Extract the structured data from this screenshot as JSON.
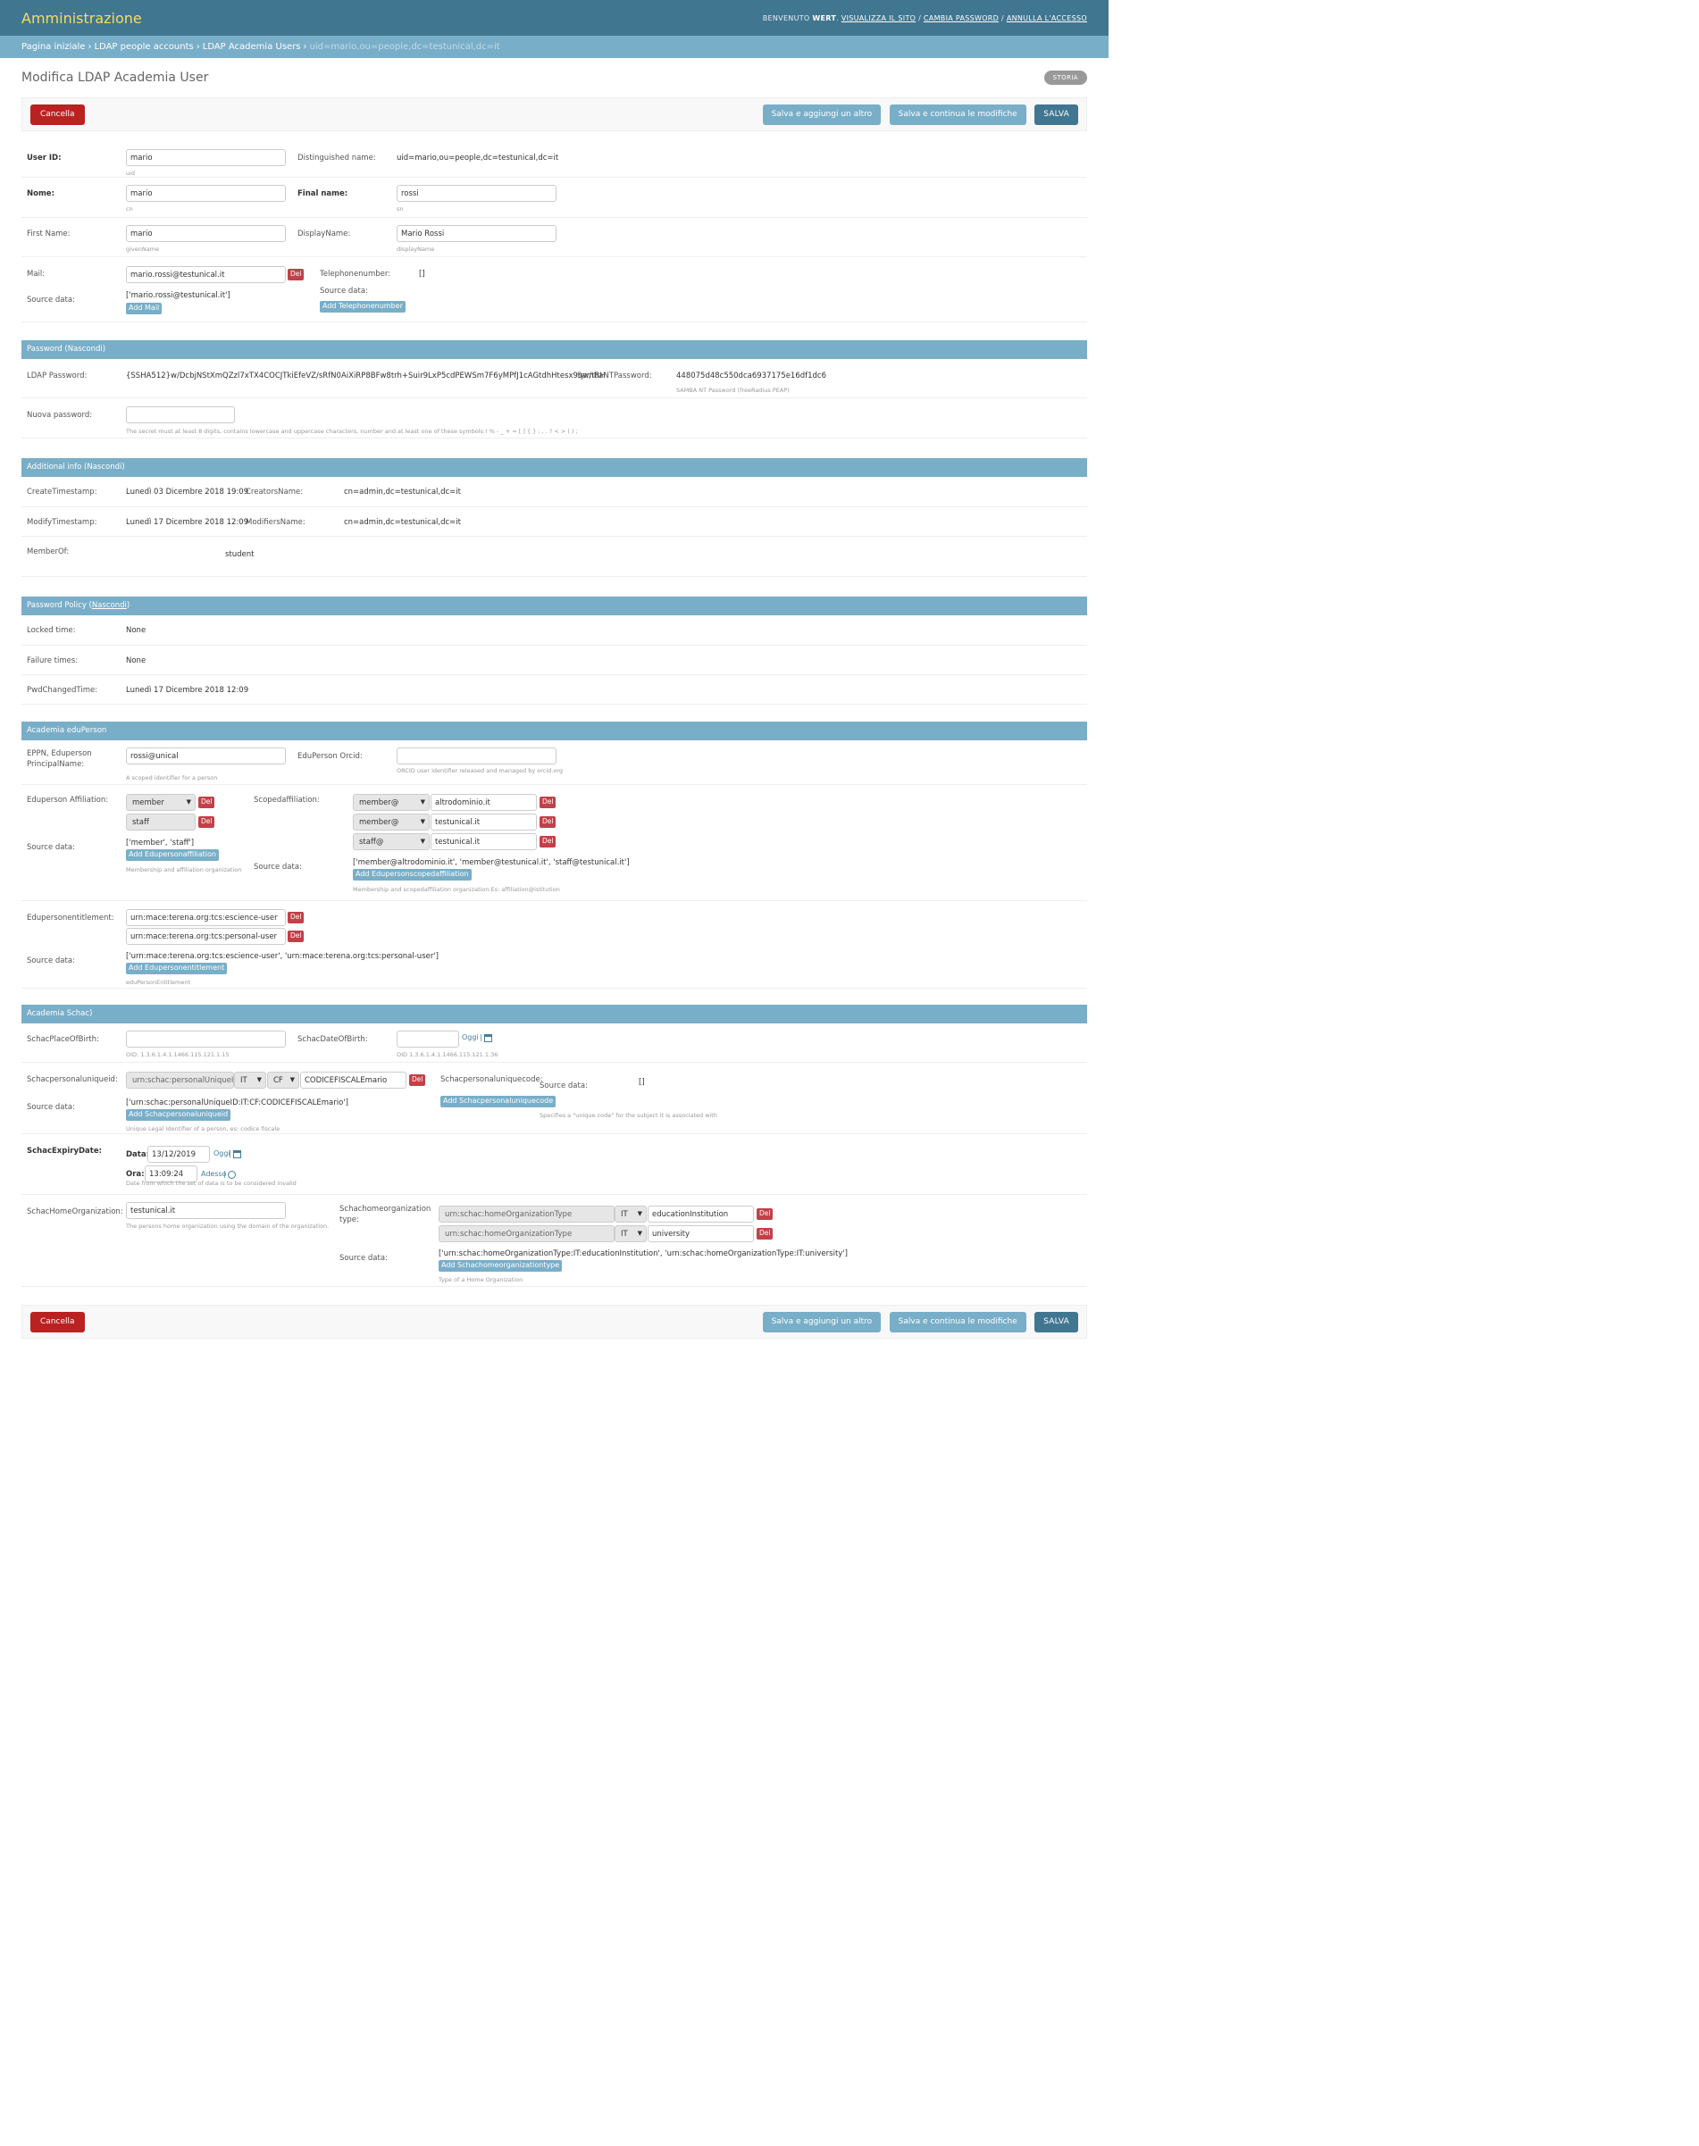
{
  "header": {
    "brand": "Amministrazione",
    "welcome": "Benvenuto",
    "user": "WERT",
    "view_site": "Visualizza il sito",
    "change_password": "Cambia password",
    "logout": "Annulla l'accesso"
  },
  "breadcrumbs": {
    "home": "Pagina iniziale",
    "app": "LDAP people accounts",
    "model": "LDAP Academia Users",
    "current": "uid=mario,ou=people,dc=testunical,dc=it"
  },
  "page_title": "Modifica LDAP Academia User",
  "history": "Storia",
  "actions": {
    "cancel": "Cancella",
    "save_add": "Salva e aggiungi un altro",
    "save_continue": "Salva e continua le modifiche",
    "save": "Salva"
  },
  "base": {
    "uid": {
      "label": "User ID:",
      "value": "mario",
      "help": "uid"
    },
    "dn": {
      "label": "Distinguished name:",
      "value": "uid=mario,ou=people,dc=testunical,dc=it"
    },
    "cn": {
      "label": "Nome:",
      "value": "mario",
      "help": "cn"
    },
    "sn": {
      "label": "Final name:",
      "value": "rossi",
      "help": "sn"
    },
    "given": {
      "label": "First Name:",
      "value": "mario",
      "help": "givenName"
    },
    "display": {
      "label": "DisplayName:",
      "value": "Mario Rossi",
      "help": "displayName"
    },
    "mail": {
      "label": "Mail:",
      "value": "mario.rossi@testunical.it",
      "source_label": "Source data:",
      "source": "['mario.rossi@testunical.it']",
      "add": "Add Mail"
    },
    "tel": {
      "label": "Telephonenumber:",
      "value": "[]",
      "source_label": "Source data:",
      "add": "Add Telephonenumber"
    },
    "del": "Del"
  },
  "password": {
    "title": "Password (Nascondi)",
    "ldap_label": "LDAP Password:",
    "ldap_value": "{SSHA512}w/DcbjNStXmQZzl7xTX4COCJTkiEfeVZ/sRfN0AiXiRP8BFw8trh+Suir9LxP5cdPEWSm7F6yMPfJ1cAGtdhHtesx9qw/tRH",
    "samba_label": "SambaNTPassword:",
    "samba_value": "448075d48c550dca6937175e16df1dc6",
    "samba_help": "SAMBA NT Password (freeRadius PEAP)",
    "new_label": "Nuova password:",
    "new_help": "The secret must at least 8 digits, contains lowercase and uppercase characters, number and at least one of these symbols:! % - _ + = [ ] { } : , . ? < > ( ) ;"
  },
  "additional": {
    "title": "Additional info (Nascondi)",
    "create_label": "CreateTimestamp:",
    "create_value": "Lunedì 03 Dicembre 2018 19:09",
    "creator_label": "CreatorsName:",
    "creator_value": "cn=admin,dc=testunical,dc=it",
    "modify_label": "ModifyTimestamp:",
    "modify_value": "Lunedì 17 Dicembre 2018 12:09",
    "modifier_label": "ModifiersName:",
    "modifier_value": "cn=admin,dc=testunical,dc=it",
    "memberof_label": "MemberOf:",
    "memberof_value": "student"
  },
  "policy": {
    "title": "Password Policy (",
    "hide": "Nascondi",
    "close": ")",
    "locked_label": "Locked time:",
    "locked_value": "None",
    "failure_label": "Failure times:",
    "failure_value": "None",
    "changed_label": "PwdChangedTime:",
    "changed_value": "Lunedì 17 Dicembre 2018 12:09"
  },
  "eduperson": {
    "title": "Academia eduPerson",
    "eppn_label": "EPPN, Eduperson PrincipalName:",
    "eppn_value": "rossi@unical",
    "eppn_help": "A scoped identifier for a person",
    "orcid_label": "EduPerson Orcid:",
    "orcid_value": "",
    "orcid_help": "ORCID user identifier released and managed by orcid.org",
    "affil_label": "Eduperson Affiliation:",
    "affil_values": [
      "member",
      "staff"
    ],
    "affil_source_label": "Source data:",
    "affil_source": "['member', 'staff']",
    "affil_add": "Add Edupersonaffiliation",
    "affil_help": "Membership and affiliation organization",
    "scoped_label": "Scopedaffiliation:",
    "scoped_prefix": [
      "member@",
      "member@",
      "staff@"
    ],
    "scoped_domain": [
      "altrodominio.it",
      "testunical.it",
      "testunical.it"
    ],
    "scoped_source_label": "Source data:",
    "scoped_source": "['member@altrodominio.it', 'member@testunical.it', 'staff@testunical.it']",
    "scoped_add": "Add Edupersonscopedaffiliation",
    "scoped_help": "Membership and scopedaffiliation organization.Es: affiliation@istitution",
    "ent_label": "Edupersonentitlement:",
    "ent_values": [
      "urn:mace:terena.org:tcs:escience-user",
      "urn:mace:terena.org:tcs:personal-user"
    ],
    "ent_source_label": "Source data:",
    "ent_source": "['urn:mace:terena.org:tcs:escience-user', 'urn:mace:terena.org:tcs:personal-user']",
    "ent_add": "Add Edupersonentitlement",
    "ent_help": "eduPersonEntitlement"
  },
  "schac": {
    "title": "Academia Schac)",
    "pob_label": "SchacPlaceOfBirth:",
    "pob_value": "",
    "pob_help": "OID: 1.3.6.1.4.1.1466.115.121.1.15",
    "dob_label": "SchacDateOfBirth:",
    "dob_value": "",
    "dob_today": "Oggi",
    "dob_sep": "|",
    "dob_help": "OID 1.3.6.1.4.1.1466.115.121.1.36",
    "puid_label": "Schacpersonaluniqueid:",
    "puid_urn": "urn:schac:personalUniqueID",
    "puid_country": "IT",
    "puid_type": "CF",
    "puid_value": "CODICEFISCALEmario",
    "puid_source_label": "Source data:",
    "puid_source": "['urn:schac:personalUniqueID:IT:CF:CODICEFISCALEmario']",
    "puid_add": "Add Schacpersonaluniqueid",
    "puid_help": "Unique Legal Identifier of a person, es: codice fiscale",
    "pucode_label": "Schacpersonaluniquecode:",
    "pucode_source_label": "Source data:",
    "pucode_value": "[]",
    "pucode_add": "Add Schacpersonaluniquecode",
    "pucode_help": "Specifies a \"unique code\" for the subject it is associated with",
    "expiry_label": "SchacExpiryDate:",
    "date_label": "Data:",
    "date_value": "13/12/2019",
    "date_today": "Oggi",
    "date_sep": "|",
    "time_label": "Ora:",
    "time_value": "13:09:24",
    "time_now": "Adesso",
    "time_sep": "|",
    "expiry_help": "Date from which the set of data is to be considered invalid",
    "home_label": "SchacHomeOrganization:",
    "home_value": "testunical.it",
    "home_help": "The persons home organization using the domain of the organization.",
    "hometype_label": "Schachomeorganizationtype:",
    "hometype_urn": [
      "urn:schac:homeOrganizationType",
      "urn:schac:homeOrganizationType"
    ],
    "hometype_country": [
      "IT",
      "IT"
    ],
    "hometype_value": [
      "educationInstitution",
      "university"
    ],
    "hometype_source_label": "Source data:",
    "hometype_source": "['urn:schac:homeOrganizationType:IT:educationInstitution', 'urn:schac:homeOrganizationType:IT:university']",
    "hometype_add": "Add Schachomeorganizationtype",
    "hometype_help": "Type of a Home Organization"
  },
  "colors": {
    "header": "#417690",
    "breadcrumbs": "#79aec8",
    "section": "#79aec8",
    "cancel": "#ba2121",
    "del": "#c24048",
    "brand": "#f5dd5d"
  },
  "icons": {
    "calendar": "calendar-icon",
    "clock": "clock-icon",
    "caret": "caret-down-icon"
  }
}
